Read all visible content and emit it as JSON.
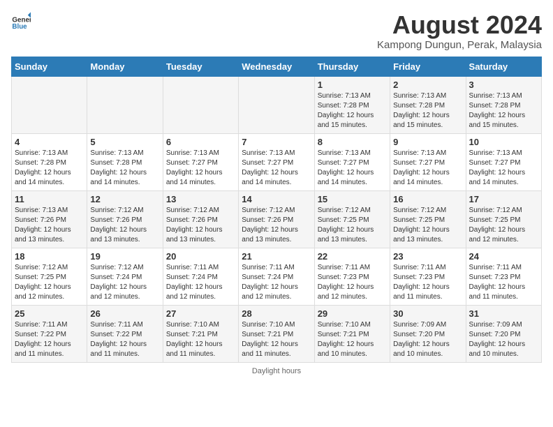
{
  "header": {
    "logo_general": "General",
    "logo_blue": "Blue",
    "main_title": "August 2024",
    "subtitle": "Kampong Dungun, Perak, Malaysia"
  },
  "days_of_week": [
    "Sunday",
    "Monday",
    "Tuesday",
    "Wednesday",
    "Thursday",
    "Friday",
    "Saturday"
  ],
  "footer": {
    "note": "Daylight hours"
  },
  "weeks": [
    [
      {
        "day": "",
        "sunrise": "",
        "sunset": "",
        "daylight": ""
      },
      {
        "day": "",
        "sunrise": "",
        "sunset": "",
        "daylight": ""
      },
      {
        "day": "",
        "sunrise": "",
        "sunset": "",
        "daylight": ""
      },
      {
        "day": "",
        "sunrise": "",
        "sunset": "",
        "daylight": ""
      },
      {
        "day": "1",
        "sunrise": "Sunrise: 7:13 AM",
        "sunset": "Sunset: 7:28 PM",
        "daylight": "Daylight: 12 hours and 15 minutes."
      },
      {
        "day": "2",
        "sunrise": "Sunrise: 7:13 AM",
        "sunset": "Sunset: 7:28 PM",
        "daylight": "Daylight: 12 hours and 15 minutes."
      },
      {
        "day": "3",
        "sunrise": "Sunrise: 7:13 AM",
        "sunset": "Sunset: 7:28 PM",
        "daylight": "Daylight: 12 hours and 15 minutes."
      }
    ],
    [
      {
        "day": "4",
        "sunrise": "Sunrise: 7:13 AM",
        "sunset": "Sunset: 7:28 PM",
        "daylight": "Daylight: 12 hours and 14 minutes."
      },
      {
        "day": "5",
        "sunrise": "Sunrise: 7:13 AM",
        "sunset": "Sunset: 7:28 PM",
        "daylight": "Daylight: 12 hours and 14 minutes."
      },
      {
        "day": "6",
        "sunrise": "Sunrise: 7:13 AM",
        "sunset": "Sunset: 7:27 PM",
        "daylight": "Daylight: 12 hours and 14 minutes."
      },
      {
        "day": "7",
        "sunrise": "Sunrise: 7:13 AM",
        "sunset": "Sunset: 7:27 PM",
        "daylight": "Daylight: 12 hours and 14 minutes."
      },
      {
        "day": "8",
        "sunrise": "Sunrise: 7:13 AM",
        "sunset": "Sunset: 7:27 PM",
        "daylight": "Daylight: 12 hours and 14 minutes."
      },
      {
        "day": "9",
        "sunrise": "Sunrise: 7:13 AM",
        "sunset": "Sunset: 7:27 PM",
        "daylight": "Daylight: 12 hours and 14 minutes."
      },
      {
        "day": "10",
        "sunrise": "Sunrise: 7:13 AM",
        "sunset": "Sunset: 7:27 PM",
        "daylight": "Daylight: 12 hours and 14 minutes."
      }
    ],
    [
      {
        "day": "11",
        "sunrise": "Sunrise: 7:13 AM",
        "sunset": "Sunset: 7:26 PM",
        "daylight": "Daylight: 12 hours and 13 minutes."
      },
      {
        "day": "12",
        "sunrise": "Sunrise: 7:12 AM",
        "sunset": "Sunset: 7:26 PM",
        "daylight": "Daylight: 12 hours and 13 minutes."
      },
      {
        "day": "13",
        "sunrise": "Sunrise: 7:12 AM",
        "sunset": "Sunset: 7:26 PM",
        "daylight": "Daylight: 12 hours and 13 minutes."
      },
      {
        "day": "14",
        "sunrise": "Sunrise: 7:12 AM",
        "sunset": "Sunset: 7:26 PM",
        "daylight": "Daylight: 12 hours and 13 minutes."
      },
      {
        "day": "15",
        "sunrise": "Sunrise: 7:12 AM",
        "sunset": "Sunset: 7:25 PM",
        "daylight": "Daylight: 12 hours and 13 minutes."
      },
      {
        "day": "16",
        "sunrise": "Sunrise: 7:12 AM",
        "sunset": "Sunset: 7:25 PM",
        "daylight": "Daylight: 12 hours and 13 minutes."
      },
      {
        "day": "17",
        "sunrise": "Sunrise: 7:12 AM",
        "sunset": "Sunset: 7:25 PM",
        "daylight": "Daylight: 12 hours and 12 minutes."
      }
    ],
    [
      {
        "day": "18",
        "sunrise": "Sunrise: 7:12 AM",
        "sunset": "Sunset: 7:25 PM",
        "daylight": "Daylight: 12 hours and 12 minutes."
      },
      {
        "day": "19",
        "sunrise": "Sunrise: 7:12 AM",
        "sunset": "Sunset: 7:24 PM",
        "daylight": "Daylight: 12 hours and 12 minutes."
      },
      {
        "day": "20",
        "sunrise": "Sunrise: 7:11 AM",
        "sunset": "Sunset: 7:24 PM",
        "daylight": "Daylight: 12 hours and 12 minutes."
      },
      {
        "day": "21",
        "sunrise": "Sunrise: 7:11 AM",
        "sunset": "Sunset: 7:24 PM",
        "daylight": "Daylight: 12 hours and 12 minutes."
      },
      {
        "day": "22",
        "sunrise": "Sunrise: 7:11 AM",
        "sunset": "Sunset: 7:23 PM",
        "daylight": "Daylight: 12 hours and 12 minutes."
      },
      {
        "day": "23",
        "sunrise": "Sunrise: 7:11 AM",
        "sunset": "Sunset: 7:23 PM",
        "daylight": "Daylight: 12 hours and 11 minutes."
      },
      {
        "day": "24",
        "sunrise": "Sunrise: 7:11 AM",
        "sunset": "Sunset: 7:23 PM",
        "daylight": "Daylight: 12 hours and 11 minutes."
      }
    ],
    [
      {
        "day": "25",
        "sunrise": "Sunrise: 7:11 AM",
        "sunset": "Sunset: 7:22 PM",
        "daylight": "Daylight: 12 hours and 11 minutes."
      },
      {
        "day": "26",
        "sunrise": "Sunrise: 7:11 AM",
        "sunset": "Sunset: 7:22 PM",
        "daylight": "Daylight: 12 hours and 11 minutes."
      },
      {
        "day": "27",
        "sunrise": "Sunrise: 7:10 AM",
        "sunset": "Sunset: 7:21 PM",
        "daylight": "Daylight: 12 hours and 11 minutes."
      },
      {
        "day": "28",
        "sunrise": "Sunrise: 7:10 AM",
        "sunset": "Sunset: 7:21 PM",
        "daylight": "Daylight: 12 hours and 11 minutes."
      },
      {
        "day": "29",
        "sunrise": "Sunrise: 7:10 AM",
        "sunset": "Sunset: 7:21 PM",
        "daylight": "Daylight: 12 hours and 10 minutes."
      },
      {
        "day": "30",
        "sunrise": "Sunrise: 7:09 AM",
        "sunset": "Sunset: 7:20 PM",
        "daylight": "Daylight: 12 hours and 10 minutes."
      },
      {
        "day": "31",
        "sunrise": "Sunrise: 7:09 AM",
        "sunset": "Sunset: 7:20 PM",
        "daylight": "Daylight: 12 hours and 10 minutes."
      }
    ]
  ]
}
